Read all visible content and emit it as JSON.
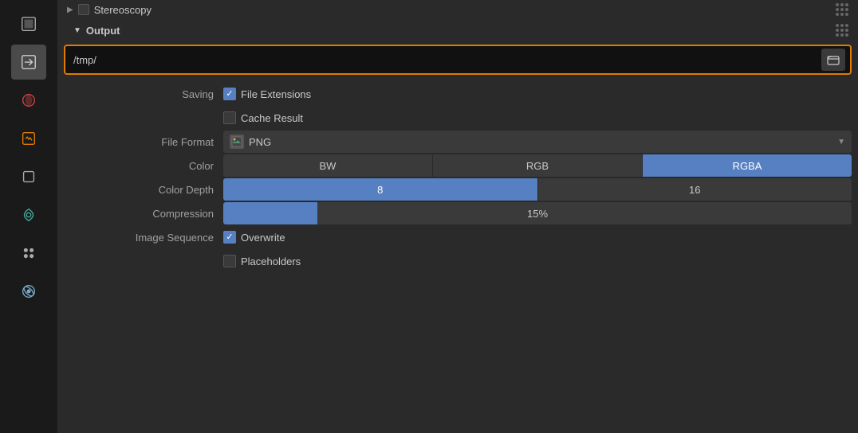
{
  "sidebar": {
    "icons": [
      {
        "name": "render-icon",
        "label": "Render Properties"
      },
      {
        "name": "output-icon",
        "label": "Output Properties"
      },
      {
        "name": "view-layer-icon",
        "label": "View Layer"
      },
      {
        "name": "scene-icon",
        "label": "Scene"
      },
      {
        "name": "object-icon",
        "label": "Object"
      },
      {
        "name": "modifier-icon",
        "label": "Modifier"
      },
      {
        "name": "particle-icon",
        "label": "Particle"
      },
      {
        "name": "physics-icon",
        "label": "Physics"
      }
    ]
  },
  "stereoscopy": {
    "section_label": "Stereoscopy",
    "checked": false
  },
  "output": {
    "section_label": "Output",
    "path_value": "/tmp/",
    "path_placeholder": "/tmp/",
    "saving_label": "Saving",
    "file_extensions_label": "File Extensions",
    "file_extensions_checked": true,
    "cache_result_label": "Cache Result",
    "cache_result_checked": false,
    "file_format_label": "File Format",
    "file_format_value": "PNG",
    "color_label": "Color",
    "color_options": [
      "BW",
      "RGB",
      "RGBA"
    ],
    "color_active": "RGBA",
    "color_depth_label": "Color Depth",
    "color_depth_options": [
      "8",
      "16"
    ],
    "color_depth_active": "8",
    "compression_label": "Compression",
    "compression_value": 15,
    "compression_display": "15%",
    "image_sequence_label": "Image Sequence",
    "overwrite_label": "Overwrite",
    "overwrite_checked": true,
    "placeholders_label": "Placeholders",
    "placeholders_checked": false
  },
  "colors": {
    "accent_orange": "#e07b00",
    "accent_blue": "#5680c2",
    "bg_dark": "#1a1a1a",
    "bg_main": "#2a2a2a",
    "bg_input": "#111111",
    "bg_btn": "#3a3a3a"
  }
}
